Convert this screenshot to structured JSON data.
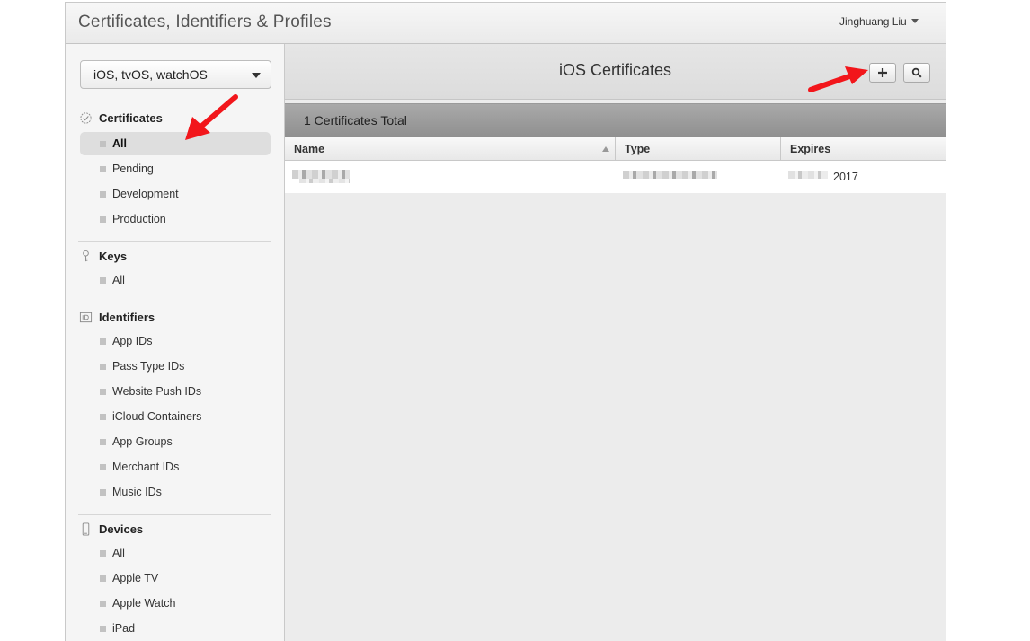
{
  "header": {
    "title": "Certificates, Identifiers & Profiles",
    "user_name": "Jinghuang Liu"
  },
  "sidebar": {
    "platform_select": "iOS, tvOS, watchOS",
    "sections": {
      "certificates": {
        "label": "Certificates",
        "icon": "certificate-seal-icon",
        "items": [
          "All",
          "Pending",
          "Development",
          "Production"
        ]
      },
      "keys": {
        "label": "Keys",
        "icon": "key-icon",
        "items": [
          "All"
        ]
      },
      "identifiers": {
        "label": "Identifiers",
        "icon": "id-card-icon",
        "items": [
          "App IDs",
          "Pass Type IDs",
          "Website Push IDs",
          "iCloud Containers",
          "App Groups",
          "Merchant IDs",
          "Music IDs"
        ]
      },
      "devices": {
        "label": "Devices",
        "icon": "phone-device-icon",
        "items": [
          "All",
          "Apple TV",
          "Apple Watch",
          "iPad"
        ]
      }
    },
    "active_item": "Certificates/All"
  },
  "main": {
    "title": "iOS Certificates",
    "add_button_icon": "plus-icon",
    "search_button_icon": "search-icon",
    "summary": "1 Certificates Total",
    "table": {
      "columns": [
        "Name",
        "Type",
        "Expires"
      ],
      "rows": [
        {
          "name": "",
          "type": "",
          "expires": "2017"
        }
      ]
    }
  },
  "annotations": {
    "arrow_color": "#f2161b"
  }
}
